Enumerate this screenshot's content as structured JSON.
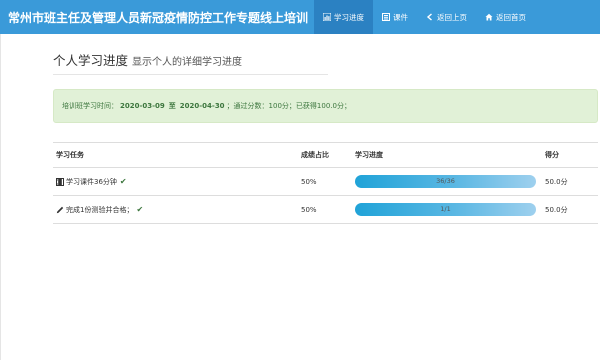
{
  "header": {
    "title": "常州市班主任及管理人员新冠疫情防控工作专题线上培训",
    "nav": [
      {
        "label": "学习进度",
        "icon": "chart-icon",
        "active": true
      },
      {
        "label": "课件",
        "icon": "list-icon",
        "active": false
      },
      {
        "label": "返回上页",
        "icon": "back-icon",
        "active": false
      },
      {
        "label": "返回首页",
        "icon": "home-icon",
        "active": false
      }
    ]
  },
  "page": {
    "title": "个人学习进度",
    "subtitle": "显示个人的详细学习进度"
  },
  "alert": {
    "prefix": "培训班学习时间：",
    "start": "2020-03-09",
    "to": "至",
    "end": "2020-04-30",
    "rest": "；通过分数：100分；已获得100.0分；"
  },
  "table": {
    "headers": [
      "学习任务",
      "成绩占比",
      "学习进度",
      "得分"
    ],
    "rows": [
      {
        "task": "学习课件36分钟",
        "icon": "film-icon",
        "ratio": "50%",
        "progress_label": "36/36",
        "progress": 1.0,
        "score": "50.0分"
      },
      {
        "task": "完成1份测验并合格；",
        "icon": "pencil-icon",
        "ratio": "50%",
        "progress_label": "1/1",
        "progress": 1.0,
        "score": "50.0分"
      }
    ]
  },
  "colors": {
    "header_bg": "#3a9ad9",
    "header_active": "#2b81c2",
    "alert_bg": "#e1f1d7",
    "alert_text": "#3c763d",
    "progress": "#20a3d8"
  }
}
